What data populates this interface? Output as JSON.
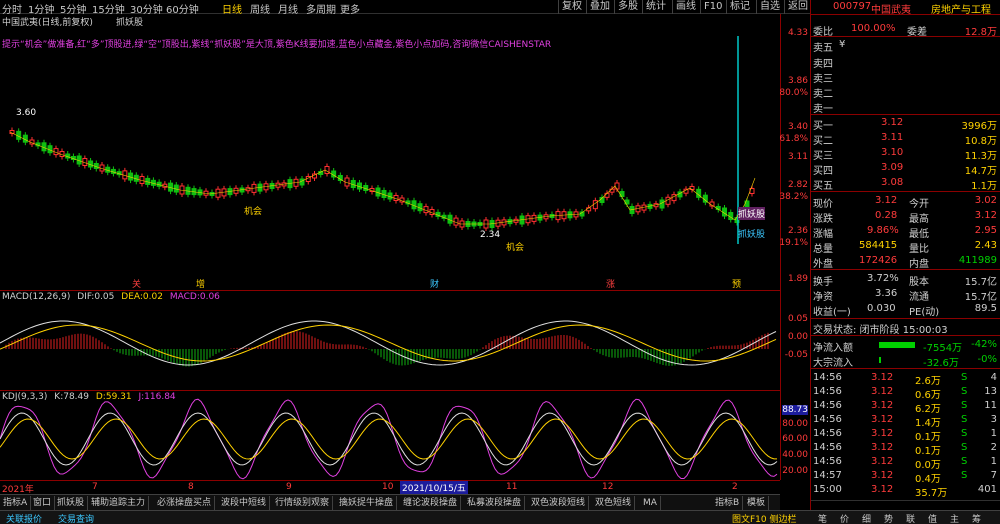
{
  "topbar": {
    "timeframes": [
      "分时",
      "1分钟",
      "5分钟",
      "15分钟",
      "30分钟",
      "60分钟",
      "日线",
      "周线",
      "月线",
      "多周期",
      "更多"
    ],
    "active": "日线",
    "buttons": [
      "复权",
      "叠加",
      "多股",
      "统计",
      "画线",
      "F10",
      "标记",
      "自选",
      "返回"
    ]
  },
  "kline": {
    "title": "中国武夷(日线,前复权)",
    "indicator_name": "抓妖股",
    "legend": "提示“机会”做准备,红“多”顶股进,绿“空”顶股出,紫线“抓妖股”是大顶,紫色K线要加速,蓝色小点藏金,紫色小点加码,咨询微信CAISHENSTAR",
    "price_high": "3.60",
    "price_low": "2.34",
    "signal_chance": "机会",
    "signal_chance2": "机会",
    "signal_yao": "抓妖股",
    "signal_yao2": "抓妖股",
    "marks": [
      "多",
      "空",
      "空",
      "多",
      "空",
      "空"
    ],
    "events": [
      "关",
      "增",
      "财",
      "涨",
      "预"
    ],
    "axis": [
      "4.33",
      "3.86",
      "80.0%",
      "3.40",
      "61.8%",
      "3.11",
      "2.82",
      "38.2%",
      "2.36",
      "19.1%",
      "1.89"
    ]
  },
  "macd": {
    "title": "MACD(12,26,9)",
    "dif_label": "DIF:",
    "dif": "0.05",
    "dea_label": "DEA:",
    "dea": "0.02",
    "macd_label": "MACD:",
    "macd": "0.06",
    "axis": [
      "0.05",
      "0.00",
      "-0.05"
    ]
  },
  "kdj": {
    "title": "KDJ(9,3,3)",
    "k_label": "K:",
    "k": "78.49",
    "d_label": "D:",
    "d": "59.31",
    "j_label": "J:",
    "j": "116.84",
    "axis": [
      "88.73",
      "80.00",
      "60.00",
      "40.00",
      "20.00",
      "0.00"
    ]
  },
  "date_axis": {
    "start": "2021年",
    "marks": [
      "7",
      "8",
      "9",
      "10",
      "11",
      "12",
      "2"
    ],
    "cursor": "2021/10/15/五",
    "end": "日线"
  },
  "tabs": [
    "指标A",
    "窗口",
    "抓妖股",
    "辅助追踪主力",
    "必涨操盘买点",
    "波段中短线",
    "行情级别观察",
    "擒妖捉牛操盘",
    "缠论波段操盘",
    "私募波段操盘",
    "双色波段短线",
    "双色短线",
    "MA",
    "指标B",
    "模板"
  ],
  "right": {
    "code": "000797",
    "name": "中国武夷",
    "industry": "房地产与工程",
    "weibi_label": "委比",
    "weibi": "100.00%",
    "weicha_label": "委差",
    "weicha": "12.8万",
    "sells": [
      {
        "label": "卖五",
        "price": "¥",
        "vol": ""
      },
      {
        "label": "卖四",
        "price": "",
        "vol": ""
      },
      {
        "label": "卖三",
        "price": "",
        "vol": ""
      },
      {
        "label": "卖二",
        "price": "",
        "vol": ""
      },
      {
        "label": "卖一",
        "price": "",
        "vol": ""
      }
    ],
    "buys": [
      {
        "label": "买一",
        "price": "3.12",
        "vol": "3996万"
      },
      {
        "label": "买二",
        "price": "3.11",
        "vol": "10.8万"
      },
      {
        "label": "买三",
        "price": "3.10",
        "vol": "11.3万"
      },
      {
        "label": "买四",
        "price": "3.09",
        "vol": "14.7万"
      },
      {
        "label": "买五",
        "price": "3.08",
        "vol": "1.1万"
      }
    ],
    "stats": [
      {
        "l1": "现价",
        "v1": "3.12",
        "c1": "r",
        "l2": "今开",
        "v2": "3.02",
        "c2": "r"
      },
      {
        "l1": "涨跌",
        "v1": "0.28",
        "c1": "r",
        "l2": "最高",
        "v2": "3.12",
        "c2": "r"
      },
      {
        "l1": "涨幅",
        "v1": "9.86%",
        "c1": "r",
        "l2": "最低",
        "v2": "2.95",
        "c2": "r"
      },
      {
        "l1": "总量",
        "v1": "584415",
        "c1": "y",
        "l2": "量比",
        "v2": "2.43",
        "c2": "y"
      },
      {
        "l1": "外盘",
        "v1": "172426",
        "c1": "r",
        "l2": "内盘",
        "v2": "411989",
        "c2": "g"
      },
      {
        "l1": "换手",
        "v1": "3.72%",
        "c1": "w",
        "l2": "股本",
        "v2": "15.7亿",
        "c2": "w"
      },
      {
        "l1": "净资",
        "v1": "3.36",
        "c1": "w",
        "l2": "流通",
        "v2": "15.7亿",
        "c2": "w"
      },
      {
        "l1": "收益(一)",
        "v1": "0.030",
        "c1": "w",
        "l2": "PE(动)",
        "v2": "89.5",
        "c2": "w"
      }
    ],
    "status": "交易状态: 闭市阶段 15:00:03",
    "flows": [
      {
        "label": "净流入额",
        "value": "-7554万",
        "pct": "-42%"
      },
      {
        "label": "大宗流入",
        "value": "-32.6万",
        "pct": "-0%"
      }
    ],
    "ticks": [
      {
        "t": "14:56",
        "p": "3.12",
        "v": "2.6万",
        "s": "S",
        "n": "4"
      },
      {
        "t": "14:56",
        "p": "3.12",
        "v": "0.6万",
        "s": "S",
        "n": "13"
      },
      {
        "t": "14:56",
        "p": "3.12",
        "v": "6.2万",
        "s": "S",
        "n": "11"
      },
      {
        "t": "14:56",
        "p": "3.12",
        "v": "1.4万",
        "s": "S",
        "n": "3"
      },
      {
        "t": "14:56",
        "p": "3.12",
        "v": "0.1万",
        "s": "S",
        "n": "1"
      },
      {
        "t": "14:56",
        "p": "3.12",
        "v": "0.1万",
        "s": "S",
        "n": "2"
      },
      {
        "t": "14:56",
        "p": "3.12",
        "v": "0.0万",
        "s": "S",
        "n": "1"
      },
      {
        "t": "14:57",
        "p": "3.12",
        "v": "0.4万",
        "s": "S",
        "n": "7"
      },
      {
        "t": "15:00",
        "p": "3.12",
        "v": "35.7万",
        "s": "",
        "n": "401"
      }
    ],
    "bottom_tabs": [
      "笔",
      "价",
      "细",
      "势",
      "联",
      "值",
      "主",
      "筹"
    ]
  },
  "bottom": {
    "left": [
      "关联报价",
      "交易查询"
    ],
    "right": "图文F10 侧边栏"
  },
  "colors": {
    "up": "#ff3b3b",
    "down": "#00c000",
    "ma_yellow": "#ffd200",
    "axis_red": "#8b0000",
    "purple": "#d040d0",
    "cyan": "#00c8c8"
  }
}
